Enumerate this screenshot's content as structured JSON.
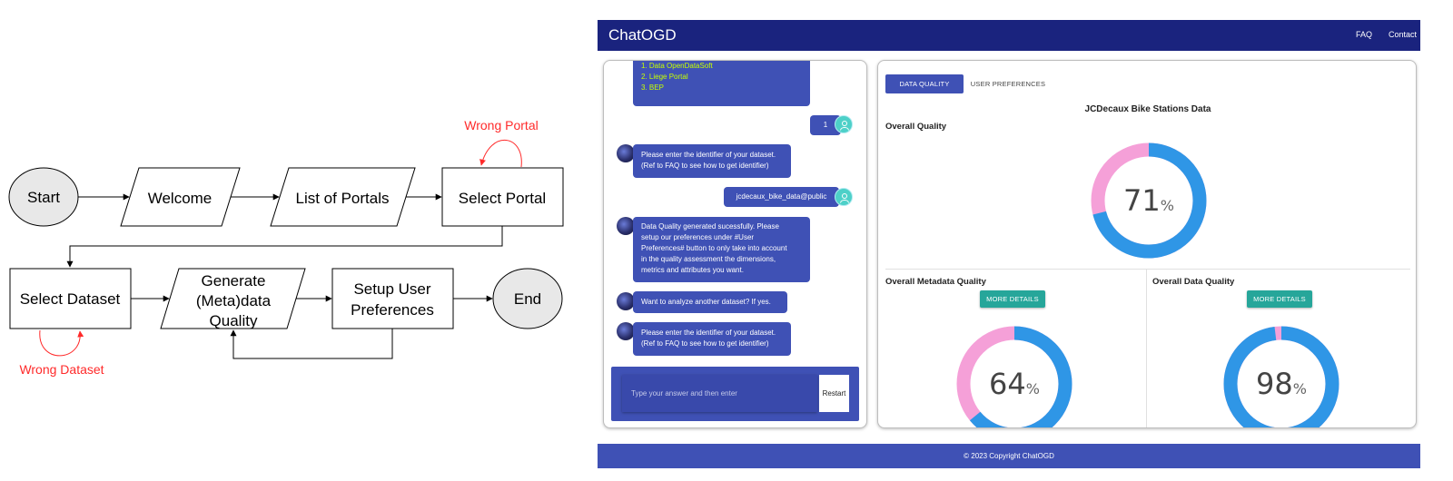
{
  "flowchart": {
    "nodes": {
      "start": "Start",
      "welcome": "Welcome",
      "list_portals": "List of Portals",
      "select_portal": "Select Portal",
      "select_dataset": "Select Dataset",
      "generate_quality_1": "Generate",
      "generate_quality_2": "(Meta)data",
      "generate_quality_3": "Quality",
      "setup_prefs_1": "Setup User",
      "setup_prefs_2": "Preferences",
      "end": "End"
    },
    "loops": {
      "wrong_portal": "Wrong Portal",
      "wrong_dataset": "Wrong Dataset"
    },
    "colors": {
      "loop": "#ff2a2a",
      "node_fill": "#e8e8e8",
      "stroke": "#000000"
    }
  },
  "app": {
    "brand": "ChatOGD",
    "nav": {
      "faq": "FAQ",
      "contact": "Contact"
    },
    "chat": {
      "portals": [
        "1. Data OpenDataSoft",
        "2. Liege Portal",
        "3. BEP"
      ],
      "user_reply_1": "1",
      "bot_msg_1": [
        "Please enter the identifier of your dataset.",
        "(Ref to FAQ to see how to get identifier)"
      ],
      "user_reply_2": "jcdecaux_bike_data@public",
      "bot_msg_2": [
        "Data Quality generated sucessfully. Please",
        "setup our preferences under #User",
        "Preferences# button to only take into account",
        "in the quality assessment the dimensions,",
        "metrics and attributes you want."
      ],
      "bot_msg_3": "Want to analyze another dataset? If yes.",
      "bot_msg_4": [
        "Please enter the identifier of your dataset.",
        "(Ref to FAQ to see how to get identifier)"
      ],
      "input_placeholder": "Type your answer and then enter",
      "restart_label": "Restart"
    },
    "dashboard": {
      "tabs": {
        "data_quality": "DATA QUALITY",
        "user_preferences": "USER PREFERENCES"
      },
      "dataset_title": "JCDecaux Bike Stations Data",
      "overall_label": "Overall Quality",
      "overall_value": 71,
      "metadata_label": "Overall Metadata Quality",
      "metadata_value": 64,
      "data_label": "Overall Data Quality",
      "data_value": 98,
      "details_label": "MORE DETAILS",
      "percent_sign": "%",
      "colors": {
        "score": "#2f96e6",
        "remainder": "#f5a0d8"
      }
    },
    "footer": "© 2023 Copyright ChatOGD"
  }
}
